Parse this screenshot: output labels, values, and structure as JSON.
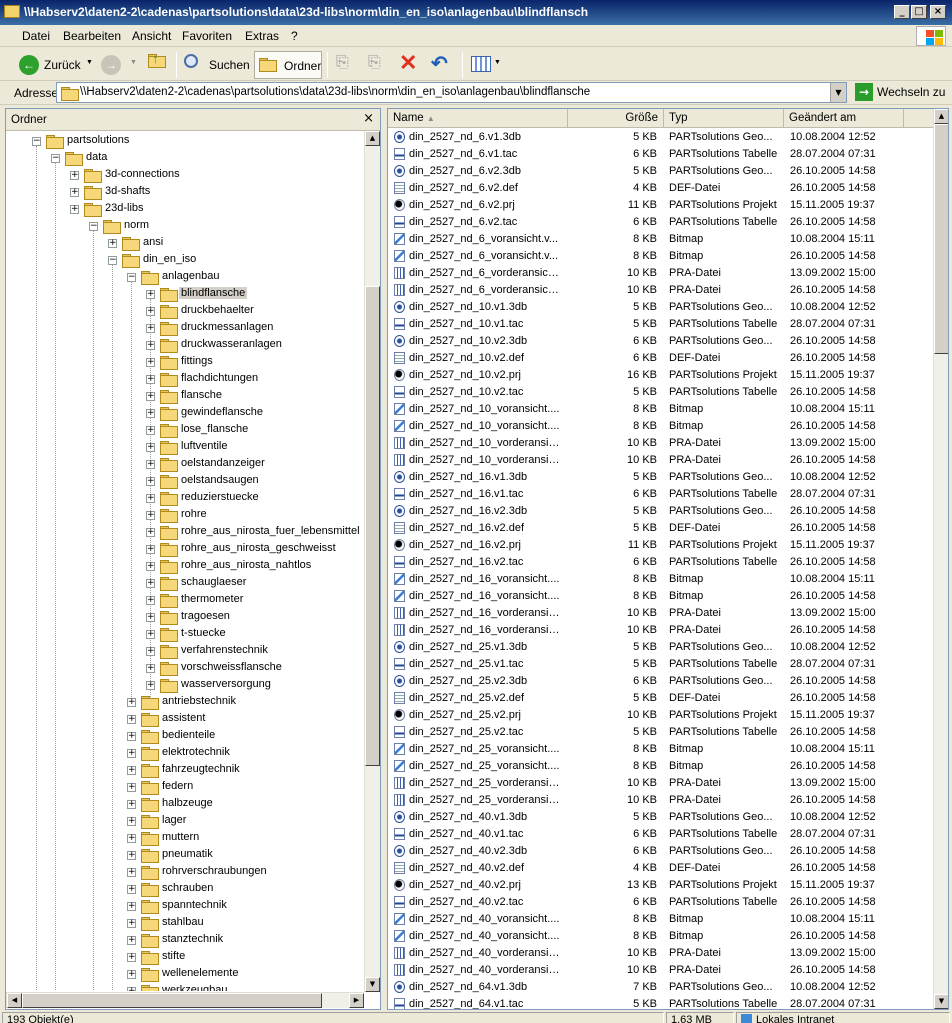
{
  "window": {
    "title": "\\\\Habserv2\\daten2-2\\cadenas\\partsolutions\\data\\23d-libs\\norm\\din_en_iso\\anlagenbau\\blindflansch"
  },
  "menu": [
    "Datei",
    "Bearbeiten",
    "Ansicht",
    "Favoriten",
    "Extras",
    "?"
  ],
  "toolbar": {
    "back": "Zurück",
    "search": "Suchen",
    "folders": "Ordner"
  },
  "address": {
    "label": "Adresse",
    "value": "\\\\Habserv2\\daten2-2\\cadenas\\partsolutions\\data\\23d-libs\\norm\\din_en_iso\\anlagenbau\\blindflansche",
    "go": "Wechseln zu"
  },
  "left_pane": {
    "title": "Ordner",
    "close": "×",
    "tree": [
      {
        "label": "partsolutions",
        "level": 0,
        "exp": "-",
        "selected": false
      },
      {
        "label": "data",
        "level": 1,
        "exp": "-",
        "selected": false
      },
      {
        "label": "3d-connections",
        "level": 2,
        "exp": "+",
        "selected": false
      },
      {
        "label": "3d-shafts",
        "level": 2,
        "exp": "+",
        "selected": false
      },
      {
        "label": "23d-libs",
        "level": 2,
        "exp": "+",
        "selected": false
      },
      {
        "label": "norm",
        "level": 3,
        "exp": "-",
        "selected": false
      },
      {
        "label": "ansi",
        "level": 4,
        "exp": "+",
        "selected": false
      },
      {
        "label": "din_en_iso",
        "level": 4,
        "exp": "-",
        "selected": false
      },
      {
        "label": "anlagenbau",
        "level": 5,
        "exp": "-",
        "selected": false
      },
      {
        "label": "blindflansche",
        "level": 6,
        "exp": "+",
        "selected": true
      },
      {
        "label": "druckbehaelter",
        "level": 6,
        "exp": "+",
        "selected": false
      },
      {
        "label": "druckmessanlagen",
        "level": 6,
        "exp": "+",
        "selected": false
      },
      {
        "label": "druckwasseranlagen",
        "level": 6,
        "exp": "+",
        "selected": false
      },
      {
        "label": "fittings",
        "level": 6,
        "exp": "+",
        "selected": false
      },
      {
        "label": "flachdichtungen",
        "level": 6,
        "exp": "+",
        "selected": false
      },
      {
        "label": "flansche",
        "level": 6,
        "exp": "+",
        "selected": false
      },
      {
        "label": "gewindeflansche",
        "level": 6,
        "exp": "+",
        "selected": false
      },
      {
        "label": "lose_flansche",
        "level": 6,
        "exp": "+",
        "selected": false
      },
      {
        "label": "luftventile",
        "level": 6,
        "exp": "+",
        "selected": false
      },
      {
        "label": "oelstandanzeiger",
        "level": 6,
        "exp": "+",
        "selected": false
      },
      {
        "label": "oelstandsaugen",
        "level": 6,
        "exp": "+",
        "selected": false
      },
      {
        "label": "reduzierstuecke",
        "level": 6,
        "exp": "+",
        "selected": false
      },
      {
        "label": "rohre",
        "level": 6,
        "exp": "+",
        "selected": false
      },
      {
        "label": "rohre_aus_nirosta_fuer_lebensmittel",
        "level": 6,
        "exp": "+",
        "selected": false
      },
      {
        "label": "rohre_aus_nirosta_geschweisst",
        "level": 6,
        "exp": "+",
        "selected": false
      },
      {
        "label": "rohre_aus_nirosta_nahtlos",
        "level": 6,
        "exp": "+",
        "selected": false
      },
      {
        "label": "schauglaeser",
        "level": 6,
        "exp": "+",
        "selected": false
      },
      {
        "label": "thermometer",
        "level": 6,
        "exp": "+",
        "selected": false
      },
      {
        "label": "tragoesen",
        "level": 6,
        "exp": "+",
        "selected": false
      },
      {
        "label": "t-stuecke",
        "level": 6,
        "exp": "+",
        "selected": false
      },
      {
        "label": "verfahrenstechnik",
        "level": 6,
        "exp": "+",
        "selected": false
      },
      {
        "label": "vorschweissflansche",
        "level": 6,
        "exp": "+",
        "selected": false
      },
      {
        "label": "wasserversorgung",
        "level": 6,
        "exp": "+",
        "selected": false
      },
      {
        "label": "antriebstechnik",
        "level": 5,
        "exp": "+",
        "selected": false
      },
      {
        "label": "assistent",
        "level": 5,
        "exp": "+",
        "selected": false
      },
      {
        "label": "bedienteile",
        "level": 5,
        "exp": "+",
        "selected": false
      },
      {
        "label": "elektrotechnik",
        "level": 5,
        "exp": "+",
        "selected": false
      },
      {
        "label": "fahrzeugtechnik",
        "level": 5,
        "exp": "+",
        "selected": false
      },
      {
        "label": "federn",
        "level": 5,
        "exp": "+",
        "selected": false
      },
      {
        "label": "halbzeuge",
        "level": 5,
        "exp": "+",
        "selected": false
      },
      {
        "label": "lager",
        "level": 5,
        "exp": "+",
        "selected": false
      },
      {
        "label": "muttern",
        "level": 5,
        "exp": "+",
        "selected": false
      },
      {
        "label": "pneumatik",
        "level": 5,
        "exp": "+",
        "selected": false
      },
      {
        "label": "rohrverschraubungen",
        "level": 5,
        "exp": "+",
        "selected": false
      },
      {
        "label": "schrauben",
        "level": 5,
        "exp": "+",
        "selected": false
      },
      {
        "label": "spanntechnik",
        "level": 5,
        "exp": "+",
        "selected": false
      },
      {
        "label": "stahlbau",
        "level": 5,
        "exp": "+",
        "selected": false
      },
      {
        "label": "stanztechnik",
        "level": 5,
        "exp": "+",
        "selected": false
      },
      {
        "label": "stifte",
        "level": 5,
        "exp": "+",
        "selected": false
      },
      {
        "label": "wellenelemente",
        "level": 5,
        "exp": "+",
        "selected": false
      },
      {
        "label": "werkzeugbau",
        "level": 5,
        "exp": "+",
        "selected": false
      }
    ]
  },
  "columns": {
    "name": "Name",
    "size": "Größe",
    "type": "Typ",
    "date": "Geändert am"
  },
  "files": [
    {
      "name": "din_2527_nd_6.v1.3db",
      "size": "5 KB",
      "type": "PARTsolutions Geo...",
      "date": "10.08.2004 12:52",
      "icon": "3db-icon"
    },
    {
      "name": "din_2527_nd_6.v1.tac",
      "size": "6 KB",
      "type": "PARTsolutions Tabelle",
      "date": "28.07.2004 07:31",
      "icon": "tac-icon"
    },
    {
      "name": "din_2527_nd_6.v2.3db",
      "size": "5 KB",
      "type": "PARTsolutions Geo...",
      "date": "26.10.2005 14:58",
      "icon": "3db-icon"
    },
    {
      "name": "din_2527_nd_6.v2.def",
      "size": "4 KB",
      "type": "DEF-Datei",
      "date": "26.10.2005 14:58",
      "icon": "def-icon"
    },
    {
      "name": "din_2527_nd_6.v2.prj",
      "size": "11 KB",
      "type": "PARTsolutions Projekt",
      "date": "15.11.2005 19:37",
      "icon": "prj-icon"
    },
    {
      "name": "din_2527_nd_6.v2.tac",
      "size": "6 KB",
      "type": "PARTsolutions Tabelle",
      "date": "26.10.2005 14:58",
      "icon": "tac-icon"
    },
    {
      "name": "din_2527_nd_6_voransicht.v...",
      "size": "8 KB",
      "type": "Bitmap",
      "date": "10.08.2004 15:11",
      "icon": "bitmap-icon"
    },
    {
      "name": "din_2527_nd_6_voransicht.v...",
      "size": "8 KB",
      "type": "Bitmap",
      "date": "26.10.2005 14:58",
      "icon": "bitmap-icon"
    },
    {
      "name": "din_2527_nd_6_vorderansich...",
      "size": "10 KB",
      "type": "PRA-Datei",
      "date": "13.09.2002 15:00",
      "icon": "pra-icon"
    },
    {
      "name": "din_2527_nd_6_vorderansich...",
      "size": "10 KB",
      "type": "PRA-Datei",
      "date": "26.10.2005 14:58",
      "icon": "pra-icon"
    },
    {
      "name": "din_2527_nd_10.v1.3db",
      "size": "5 KB",
      "type": "PARTsolutions Geo...",
      "date": "10.08.2004 12:52",
      "icon": "3db-icon"
    },
    {
      "name": "din_2527_nd_10.v1.tac",
      "size": "5 KB",
      "type": "PARTsolutions Tabelle",
      "date": "28.07.2004 07:31",
      "icon": "tac-icon"
    },
    {
      "name": "din_2527_nd_10.v2.3db",
      "size": "6 KB",
      "type": "PARTsolutions Geo...",
      "date": "26.10.2005 14:58",
      "icon": "3db-icon"
    },
    {
      "name": "din_2527_nd_10.v2.def",
      "size": "6 KB",
      "type": "DEF-Datei",
      "date": "26.10.2005 14:58",
      "icon": "def-icon"
    },
    {
      "name": "din_2527_nd_10.v2.prj",
      "size": "16 KB",
      "type": "PARTsolutions Projekt",
      "date": "15.11.2005 19:37",
      "icon": "prj-icon"
    },
    {
      "name": "din_2527_nd_10.v2.tac",
      "size": "5 KB",
      "type": "PARTsolutions Tabelle",
      "date": "26.10.2005 14:58",
      "icon": "tac-icon"
    },
    {
      "name": "din_2527_nd_10_voransicht....",
      "size": "8 KB",
      "type": "Bitmap",
      "date": "10.08.2004 15:11",
      "icon": "bitmap-icon"
    },
    {
      "name": "din_2527_nd_10_voransicht....",
      "size": "8 KB",
      "type": "Bitmap",
      "date": "26.10.2005 14:58",
      "icon": "bitmap-icon"
    },
    {
      "name": "din_2527_nd_10_vorderansic...",
      "size": "10 KB",
      "type": "PRA-Datei",
      "date": "13.09.2002 15:00",
      "icon": "pra-icon"
    },
    {
      "name": "din_2527_nd_10_vorderansic...",
      "size": "10 KB",
      "type": "PRA-Datei",
      "date": "26.10.2005 14:58",
      "icon": "pra-icon"
    },
    {
      "name": "din_2527_nd_16.v1.3db",
      "size": "5 KB",
      "type": "PARTsolutions Geo...",
      "date": "10.08.2004 12:52",
      "icon": "3db-icon"
    },
    {
      "name": "din_2527_nd_16.v1.tac",
      "size": "6 KB",
      "type": "PARTsolutions Tabelle",
      "date": "28.07.2004 07:31",
      "icon": "tac-icon"
    },
    {
      "name": "din_2527_nd_16.v2.3db",
      "size": "5 KB",
      "type": "PARTsolutions Geo...",
      "date": "26.10.2005 14:58",
      "icon": "3db-icon"
    },
    {
      "name": "din_2527_nd_16.v2.def",
      "size": "5 KB",
      "type": "DEF-Datei",
      "date": "26.10.2005 14:58",
      "icon": "def-icon"
    },
    {
      "name": "din_2527_nd_16.v2.prj",
      "size": "11 KB",
      "type": "PARTsolutions Projekt",
      "date": "15.11.2005 19:37",
      "icon": "prj-icon"
    },
    {
      "name": "din_2527_nd_16.v2.tac",
      "size": "6 KB",
      "type": "PARTsolutions Tabelle",
      "date": "26.10.2005 14:58",
      "icon": "tac-icon"
    },
    {
      "name": "din_2527_nd_16_voransicht....",
      "size": "8 KB",
      "type": "Bitmap",
      "date": "10.08.2004 15:11",
      "icon": "bitmap-icon"
    },
    {
      "name": "din_2527_nd_16_voransicht....",
      "size": "8 KB",
      "type": "Bitmap",
      "date": "26.10.2005 14:58",
      "icon": "bitmap-icon"
    },
    {
      "name": "din_2527_nd_16_vorderansic...",
      "size": "10 KB",
      "type": "PRA-Datei",
      "date": "13.09.2002 15:00",
      "icon": "pra-icon"
    },
    {
      "name": "din_2527_nd_16_vorderansic...",
      "size": "10 KB",
      "type": "PRA-Datei",
      "date": "26.10.2005 14:58",
      "icon": "pra-icon"
    },
    {
      "name": "din_2527_nd_25.v1.3db",
      "size": "5 KB",
      "type": "PARTsolutions Geo...",
      "date": "10.08.2004 12:52",
      "icon": "3db-icon"
    },
    {
      "name": "din_2527_nd_25.v1.tac",
      "size": "5 KB",
      "type": "PARTsolutions Tabelle",
      "date": "28.07.2004 07:31",
      "icon": "tac-icon"
    },
    {
      "name": "din_2527_nd_25.v2.3db",
      "size": "6 KB",
      "type": "PARTsolutions Geo...",
      "date": "26.10.2005 14:58",
      "icon": "3db-icon"
    },
    {
      "name": "din_2527_nd_25.v2.def",
      "size": "5 KB",
      "type": "DEF-Datei",
      "date": "26.10.2005 14:58",
      "icon": "def-icon"
    },
    {
      "name": "din_2527_nd_25.v2.prj",
      "size": "10 KB",
      "type": "PARTsolutions Projekt",
      "date": "15.11.2005 19:37",
      "icon": "prj-icon"
    },
    {
      "name": "din_2527_nd_25.v2.tac",
      "size": "5 KB",
      "type": "PARTsolutions Tabelle",
      "date": "26.10.2005 14:58",
      "icon": "tac-icon"
    },
    {
      "name": "din_2527_nd_25_voransicht....",
      "size": "8 KB",
      "type": "Bitmap",
      "date": "10.08.2004 15:11",
      "icon": "bitmap-icon"
    },
    {
      "name": "din_2527_nd_25_voransicht....",
      "size": "8 KB",
      "type": "Bitmap",
      "date": "26.10.2005 14:58",
      "icon": "bitmap-icon"
    },
    {
      "name": "din_2527_nd_25_vorderansic...",
      "size": "10 KB",
      "type": "PRA-Datei",
      "date": "13.09.2002 15:00",
      "icon": "pra-icon"
    },
    {
      "name": "din_2527_nd_25_vorderansic...",
      "size": "10 KB",
      "type": "PRA-Datei",
      "date": "26.10.2005 14:58",
      "icon": "pra-icon"
    },
    {
      "name": "din_2527_nd_40.v1.3db",
      "size": "5 KB",
      "type": "PARTsolutions Geo...",
      "date": "10.08.2004 12:52",
      "icon": "3db-icon"
    },
    {
      "name": "din_2527_nd_40.v1.tac",
      "size": "6 KB",
      "type": "PARTsolutions Tabelle",
      "date": "28.07.2004 07:31",
      "icon": "tac-icon"
    },
    {
      "name": "din_2527_nd_40.v2.3db",
      "size": "6 KB",
      "type": "PARTsolutions Geo...",
      "date": "26.10.2005 14:58",
      "icon": "3db-icon"
    },
    {
      "name": "din_2527_nd_40.v2.def",
      "size": "4 KB",
      "type": "DEF-Datei",
      "date": "26.10.2005 14:58",
      "icon": "def-icon"
    },
    {
      "name": "din_2527_nd_40.v2.prj",
      "size": "13 KB",
      "type": "PARTsolutions Projekt",
      "date": "15.11.2005 19:37",
      "icon": "prj-icon"
    },
    {
      "name": "din_2527_nd_40.v2.tac",
      "size": "6 KB",
      "type": "PARTsolutions Tabelle",
      "date": "26.10.2005 14:58",
      "icon": "tac-icon"
    },
    {
      "name": "din_2527_nd_40_voransicht....",
      "size": "8 KB",
      "type": "Bitmap",
      "date": "10.08.2004 15:11",
      "icon": "bitmap-icon"
    },
    {
      "name": "din_2527_nd_40_voransicht....",
      "size": "8 KB",
      "type": "Bitmap",
      "date": "26.10.2005 14:58",
      "icon": "bitmap-icon"
    },
    {
      "name": "din_2527_nd_40_vorderansic...",
      "size": "10 KB",
      "type": "PRA-Datei",
      "date": "13.09.2002 15:00",
      "icon": "pra-icon"
    },
    {
      "name": "din_2527_nd_40_vorderansic...",
      "size": "10 KB",
      "type": "PRA-Datei",
      "date": "26.10.2005 14:58",
      "icon": "pra-icon"
    },
    {
      "name": "din_2527_nd_64.v1.3db",
      "size": "7 KB",
      "type": "PARTsolutions Geo...",
      "date": "10.08.2004 12:52",
      "icon": "3db-icon"
    },
    {
      "name": "din_2527_nd_64.v1.tac",
      "size": "5 KB",
      "type": "PARTsolutions Tabelle",
      "date": "28.07.2004 07:31",
      "icon": "tac-icon"
    }
  ],
  "status": {
    "objects": "193 Objekt(e)",
    "size": "1,63 MB",
    "zone": "Lokales Intranet"
  }
}
